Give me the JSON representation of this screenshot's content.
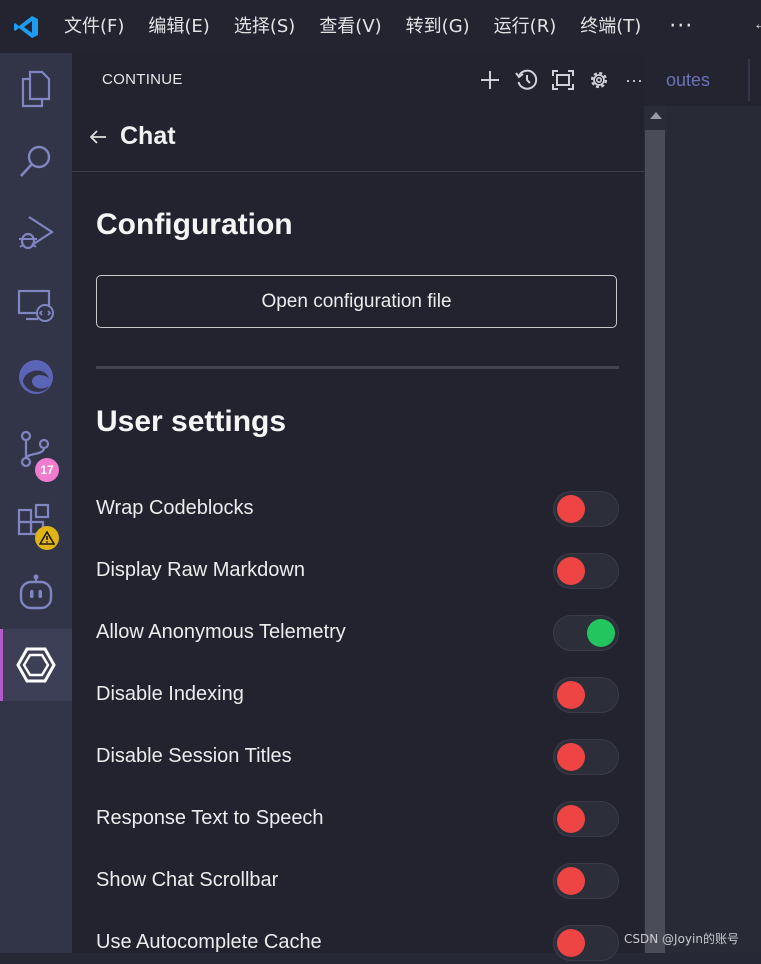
{
  "menubar": {
    "items": [
      "文件(F)",
      "编辑(E)",
      "选择(S)",
      "查看(V)",
      "转到(G)",
      "运行(R)",
      "终端(T)"
    ],
    "more": "···"
  },
  "activitybar": {
    "items": [
      {
        "name": "explorer-icon"
      },
      {
        "name": "search-icon"
      },
      {
        "name": "run-debug-icon"
      },
      {
        "name": "remote-explorer-icon"
      },
      {
        "name": "edge-icon"
      },
      {
        "name": "source-control-icon",
        "badge": "17"
      },
      {
        "name": "extensions-icon",
        "badge": "⚠"
      },
      {
        "name": "copilot-bot-icon"
      },
      {
        "name": "continue-icon",
        "active": true
      }
    ]
  },
  "panel": {
    "title": "CONTINUE",
    "chat_title": "Chat",
    "configuration_heading": "Configuration",
    "open_config_label": "Open configuration file",
    "user_settings_heading": "User settings",
    "settings": [
      {
        "label": "Wrap Codeblocks",
        "on": false
      },
      {
        "label": "Display Raw Markdown",
        "on": false
      },
      {
        "label": "Allow Anonymous Telemetry",
        "on": true
      },
      {
        "label": "Disable Indexing",
        "on": false
      },
      {
        "label": "Disable Session Titles",
        "on": false
      },
      {
        "label": "Response Text to Speech",
        "on": false
      },
      {
        "label": "Show Chat Scrollbar",
        "on": false
      },
      {
        "label": "Use Autocomplete Cache",
        "on": false
      }
    ]
  },
  "editor": {
    "tab_fragment": "outes"
  },
  "watermark": "CSDN @Joyin的账号",
  "colors": {
    "toggle_off": "#ef4444",
    "toggle_on": "#22c55e",
    "active_indicator": "#b25ac9",
    "badge_pink": "#f07ccf",
    "badge_warning": "#e0b416"
  }
}
